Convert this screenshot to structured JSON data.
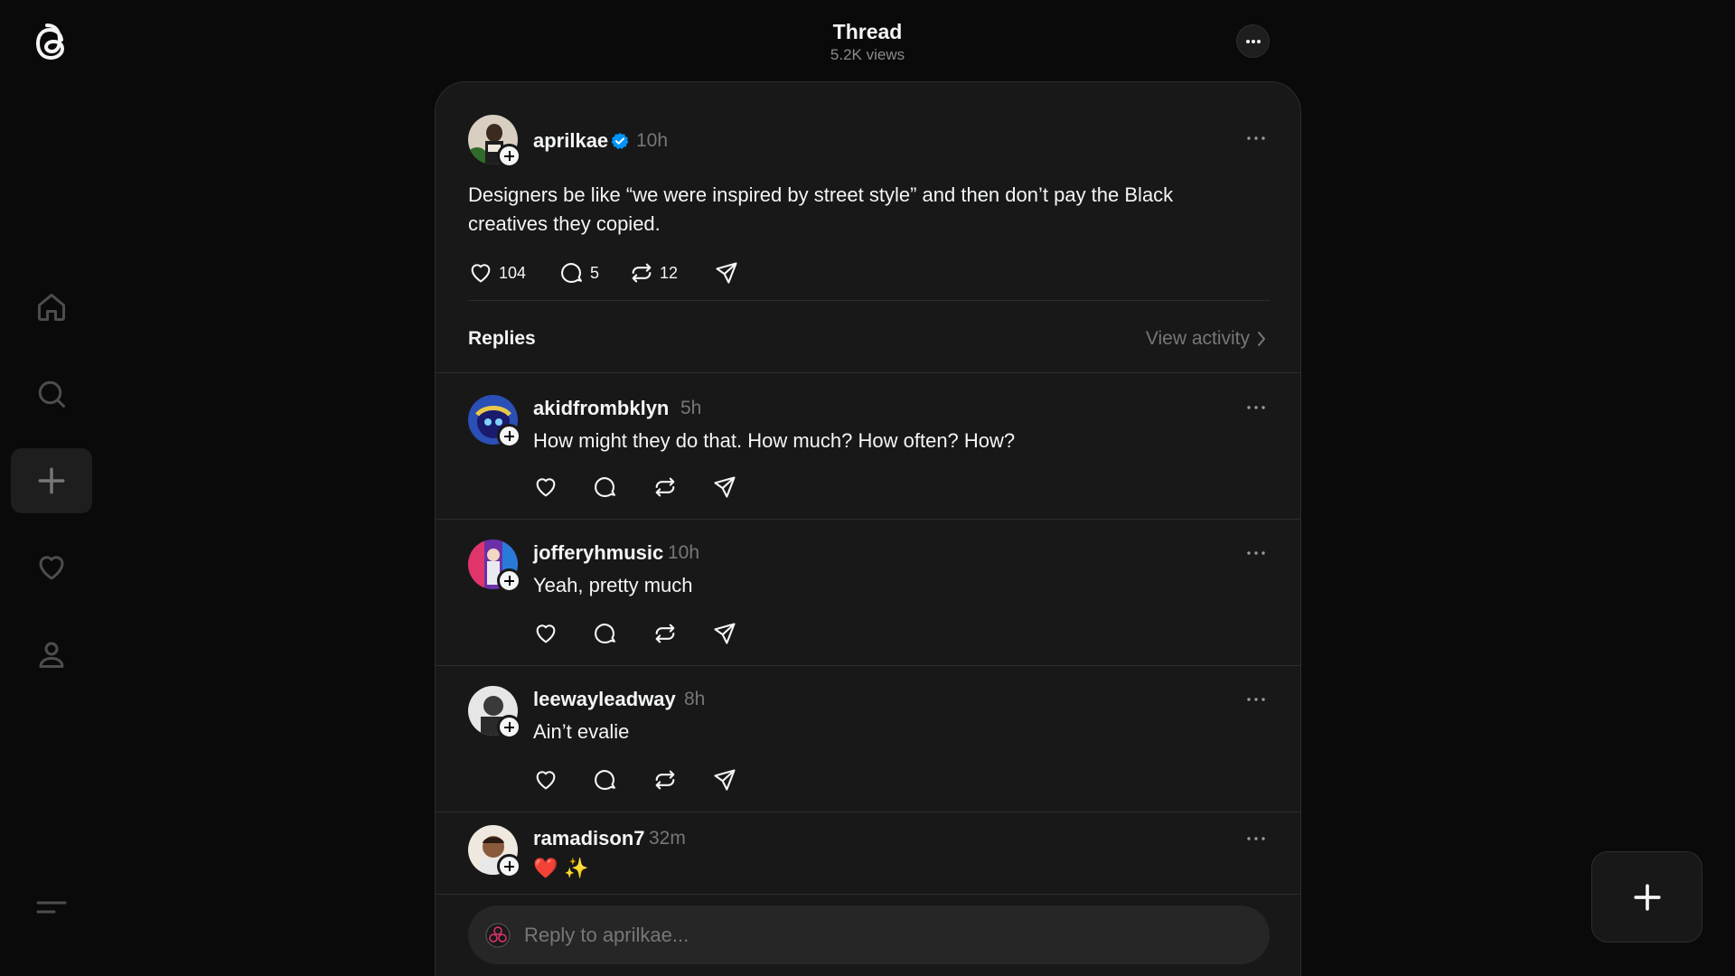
{
  "header": {
    "title": "Thread",
    "views": "5.2K views"
  },
  "post": {
    "username": "aprilkae",
    "time": "10h",
    "verified": true,
    "text": "Designers be like “we were inspired by street style” and then don’t pay the Black creatives they copied.",
    "likes": "104",
    "comments": "5",
    "reposts": "12"
  },
  "replies_section": {
    "label": "Replies",
    "view_activity": "View activity"
  },
  "replies": [
    {
      "username": "akidfrombklyn",
      "time": "5h",
      "text": "How might they do that. How much? How often? How?"
    },
    {
      "username": "jofferyhmusic",
      "time": "10h",
      "text": "Yeah, pretty much"
    },
    {
      "username": "leewayleadway",
      "time": "8h",
      "text": "Ain’t evalie"
    },
    {
      "username": "ramadison7",
      "time": "32m",
      "text": "❤️ ✨"
    }
  ],
  "reply_bar": {
    "placeholder": "Reply to aprilkae..."
  },
  "icons": {
    "logo": "threads-logo-icon",
    "nav": [
      "home-icon",
      "search-icon",
      "plus-icon",
      "heart-icon",
      "user-icon",
      "menu-icon"
    ],
    "actions": [
      "heart-icon",
      "comment-icon",
      "repost-icon",
      "share-icon"
    ]
  },
  "colors": {
    "background": "#0a0a0a",
    "panel": "#181818",
    "verified": "#0095f6",
    "muted": "#777777"
  }
}
